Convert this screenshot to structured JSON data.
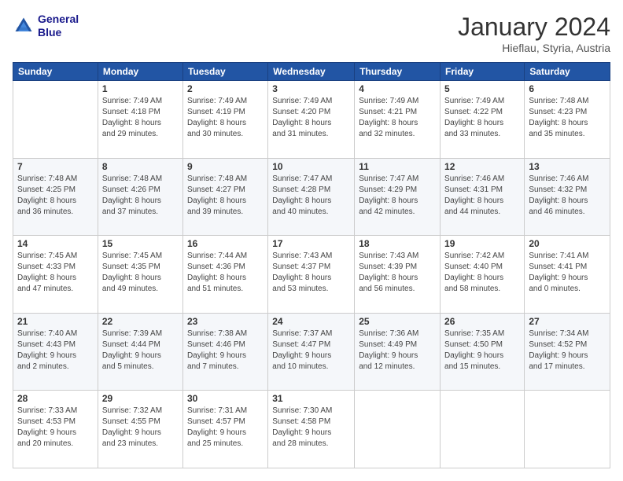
{
  "logo": {
    "line1": "General",
    "line2": "Blue"
  },
  "title": "January 2024",
  "location": "Hieflau, Styria, Austria",
  "header_days": [
    "Sunday",
    "Monday",
    "Tuesday",
    "Wednesday",
    "Thursday",
    "Friday",
    "Saturday"
  ],
  "weeks": [
    [
      {
        "num": "",
        "info": ""
      },
      {
        "num": "1",
        "info": "Sunrise: 7:49 AM\nSunset: 4:18 PM\nDaylight: 8 hours\nand 29 minutes."
      },
      {
        "num": "2",
        "info": "Sunrise: 7:49 AM\nSunset: 4:19 PM\nDaylight: 8 hours\nand 30 minutes."
      },
      {
        "num": "3",
        "info": "Sunrise: 7:49 AM\nSunset: 4:20 PM\nDaylight: 8 hours\nand 31 minutes."
      },
      {
        "num": "4",
        "info": "Sunrise: 7:49 AM\nSunset: 4:21 PM\nDaylight: 8 hours\nand 32 minutes."
      },
      {
        "num": "5",
        "info": "Sunrise: 7:49 AM\nSunset: 4:22 PM\nDaylight: 8 hours\nand 33 minutes."
      },
      {
        "num": "6",
        "info": "Sunrise: 7:48 AM\nSunset: 4:23 PM\nDaylight: 8 hours\nand 35 minutes."
      }
    ],
    [
      {
        "num": "7",
        "info": "Sunrise: 7:48 AM\nSunset: 4:25 PM\nDaylight: 8 hours\nand 36 minutes."
      },
      {
        "num": "8",
        "info": "Sunrise: 7:48 AM\nSunset: 4:26 PM\nDaylight: 8 hours\nand 37 minutes."
      },
      {
        "num": "9",
        "info": "Sunrise: 7:48 AM\nSunset: 4:27 PM\nDaylight: 8 hours\nand 39 minutes."
      },
      {
        "num": "10",
        "info": "Sunrise: 7:47 AM\nSunset: 4:28 PM\nDaylight: 8 hours\nand 40 minutes."
      },
      {
        "num": "11",
        "info": "Sunrise: 7:47 AM\nSunset: 4:29 PM\nDaylight: 8 hours\nand 42 minutes."
      },
      {
        "num": "12",
        "info": "Sunrise: 7:46 AM\nSunset: 4:31 PM\nDaylight: 8 hours\nand 44 minutes."
      },
      {
        "num": "13",
        "info": "Sunrise: 7:46 AM\nSunset: 4:32 PM\nDaylight: 8 hours\nand 46 minutes."
      }
    ],
    [
      {
        "num": "14",
        "info": "Sunrise: 7:45 AM\nSunset: 4:33 PM\nDaylight: 8 hours\nand 47 minutes."
      },
      {
        "num": "15",
        "info": "Sunrise: 7:45 AM\nSunset: 4:35 PM\nDaylight: 8 hours\nand 49 minutes."
      },
      {
        "num": "16",
        "info": "Sunrise: 7:44 AM\nSunset: 4:36 PM\nDaylight: 8 hours\nand 51 minutes."
      },
      {
        "num": "17",
        "info": "Sunrise: 7:43 AM\nSunset: 4:37 PM\nDaylight: 8 hours\nand 53 minutes."
      },
      {
        "num": "18",
        "info": "Sunrise: 7:43 AM\nSunset: 4:39 PM\nDaylight: 8 hours\nand 56 minutes."
      },
      {
        "num": "19",
        "info": "Sunrise: 7:42 AM\nSunset: 4:40 PM\nDaylight: 8 hours\nand 58 minutes."
      },
      {
        "num": "20",
        "info": "Sunrise: 7:41 AM\nSunset: 4:41 PM\nDaylight: 9 hours\nand 0 minutes."
      }
    ],
    [
      {
        "num": "21",
        "info": "Sunrise: 7:40 AM\nSunset: 4:43 PM\nDaylight: 9 hours\nand 2 minutes."
      },
      {
        "num": "22",
        "info": "Sunrise: 7:39 AM\nSunset: 4:44 PM\nDaylight: 9 hours\nand 5 minutes."
      },
      {
        "num": "23",
        "info": "Sunrise: 7:38 AM\nSunset: 4:46 PM\nDaylight: 9 hours\nand 7 minutes."
      },
      {
        "num": "24",
        "info": "Sunrise: 7:37 AM\nSunset: 4:47 PM\nDaylight: 9 hours\nand 10 minutes."
      },
      {
        "num": "25",
        "info": "Sunrise: 7:36 AM\nSunset: 4:49 PM\nDaylight: 9 hours\nand 12 minutes."
      },
      {
        "num": "26",
        "info": "Sunrise: 7:35 AM\nSunset: 4:50 PM\nDaylight: 9 hours\nand 15 minutes."
      },
      {
        "num": "27",
        "info": "Sunrise: 7:34 AM\nSunset: 4:52 PM\nDaylight: 9 hours\nand 17 minutes."
      }
    ],
    [
      {
        "num": "28",
        "info": "Sunrise: 7:33 AM\nSunset: 4:53 PM\nDaylight: 9 hours\nand 20 minutes."
      },
      {
        "num": "29",
        "info": "Sunrise: 7:32 AM\nSunset: 4:55 PM\nDaylight: 9 hours\nand 23 minutes."
      },
      {
        "num": "30",
        "info": "Sunrise: 7:31 AM\nSunset: 4:57 PM\nDaylight: 9 hours\nand 25 minutes."
      },
      {
        "num": "31",
        "info": "Sunrise: 7:30 AM\nSunset: 4:58 PM\nDaylight: 9 hours\nand 28 minutes."
      },
      {
        "num": "",
        "info": ""
      },
      {
        "num": "",
        "info": ""
      },
      {
        "num": "",
        "info": ""
      }
    ]
  ]
}
